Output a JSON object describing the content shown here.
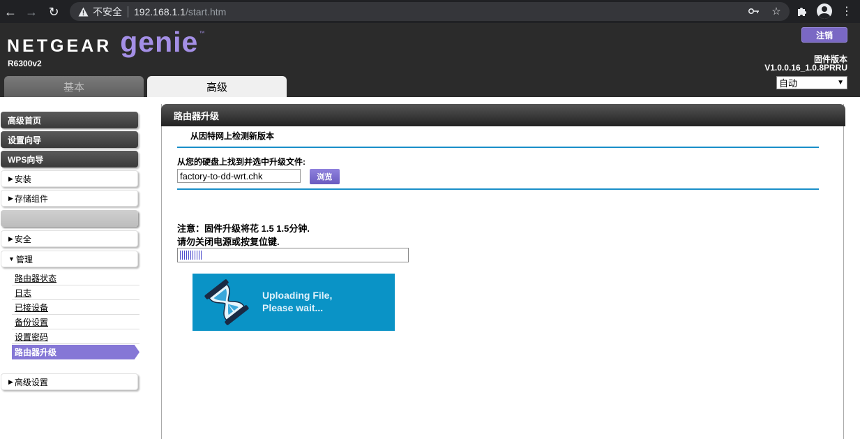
{
  "browser": {
    "insecure_label": "不安全",
    "url_host": "192.168.1.1",
    "url_path": "/start.htm"
  },
  "header": {
    "brand": "NETGEAR",
    "product": "genie",
    "tm": "™",
    "model": "R6300v2",
    "logout_label": "注销",
    "firmware_label": "固件版本",
    "firmware_version": "V1.0.0.16_1.0.8PRRU",
    "language_selected": "自动",
    "tabs": [
      {
        "label": "基本",
        "active": false
      },
      {
        "label": "高级",
        "active": true
      }
    ]
  },
  "sidebar": {
    "top_items": [
      "高级首页",
      "设置向导",
      "WPS向导"
    ],
    "sections": [
      {
        "label": "安装",
        "expanded": false
      },
      {
        "label": "存储组件",
        "expanded": false
      },
      {
        "label": "",
        "expanded": false
      },
      {
        "label": "安全",
        "expanded": false
      },
      {
        "label": "管理",
        "expanded": true
      }
    ],
    "sub_items": [
      "路由器状态",
      "日志",
      "已接设备",
      "备份设置",
      "设置密码",
      "路由器升级"
    ],
    "active_sub": "路由器升级",
    "bottom_section": "高级设置"
  },
  "main": {
    "title": "路由器升级",
    "check_online": "从因特网上检测新版本",
    "find_file": "从您的硬盘上找到并选中升级文件:",
    "file_value": "factory-to-dd-wrt.chk",
    "browse_label": "浏览",
    "note_line1": "注意：固件升级将花 1.5 1.5分钟.",
    "note_line2": "请勿关闭电源或按复位键.",
    "progress_fraction": 0.1,
    "upload_line1": "Uploading File,",
    "upload_line2": "Please wait..."
  },
  "colors": {
    "accent_purple": "#8577d6",
    "upload_blue": "#0a93c6",
    "divider_blue": "#1a8fc9"
  }
}
